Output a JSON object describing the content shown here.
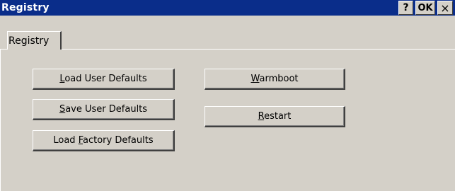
{
  "window": {
    "title": "Registry",
    "help_label": "?",
    "ok_label": "OK",
    "close_label": "×"
  },
  "tabs": [
    {
      "label": "Registry",
      "active": true
    }
  ],
  "buttons": {
    "load_user_defaults": {
      "pre": "",
      "mnemonic": "L",
      "post": "oad User Defaults"
    },
    "save_user_defaults": {
      "pre": "",
      "mnemonic": "S",
      "post": "ave User Defaults"
    },
    "load_factory_defaults": {
      "pre": "Load ",
      "mnemonic": "F",
      "post": "actory Defaults"
    },
    "warmboot": {
      "pre": "",
      "mnemonic": "W",
      "post": "armboot"
    },
    "restart": {
      "pre": "",
      "mnemonic": "R",
      "post": "estart"
    }
  },
  "colors": {
    "titlebar_bg": "#0a2d8a",
    "face": "#d4d0c8"
  }
}
